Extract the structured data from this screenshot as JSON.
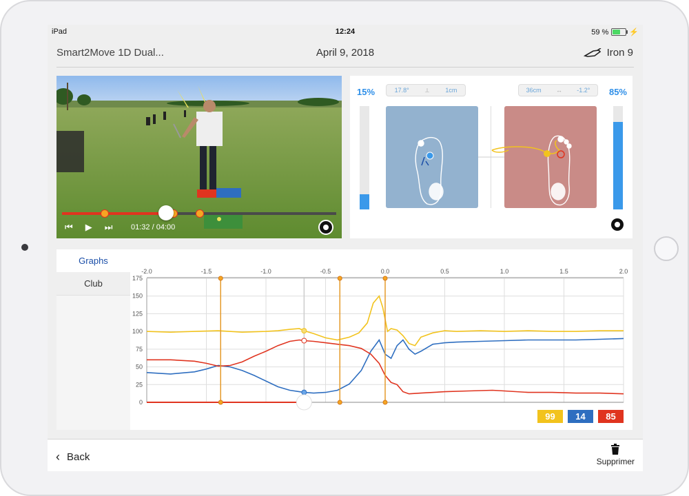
{
  "status": {
    "device": "iPad",
    "time": "12:24",
    "battery": "59 %",
    "battery_level": 0.59
  },
  "header": {
    "app_title": "Smart2Move 1D Dual...",
    "date": "April 9, 2018",
    "club": "Iron 9"
  },
  "video": {
    "current_time": "01:32",
    "duration": "/ 04:00",
    "progress": 0.38
  },
  "balance": {
    "left_pct": "15%",
    "right_pct": "85%",
    "left_level": 0.15,
    "right_level": 0.85,
    "left_angle": "17.8°",
    "left_distance": "1cm",
    "right_distance": "36cm",
    "right_angle": "-1.2°",
    "colors": {
      "left_pad": "#93b2cf",
      "right_pad": "#c98b87",
      "accent": "#2f8fe8"
    }
  },
  "tabs": [
    {
      "label": "Graphs"
    },
    {
      "label": "Club"
    }
  ],
  "legend": {
    "yellow": "99",
    "blue": "14",
    "red": "85"
  },
  "chart_data": {
    "type": "line",
    "x_ticks": [
      "-2.0",
      "-1.5",
      "-1.0",
      "-0.5",
      "0.0",
      "0.5",
      "1.0",
      "1.5",
      "2.0"
    ],
    "y_ticks": [
      "0",
      "25",
      "50",
      "75",
      "100",
      "125",
      "150",
      "175"
    ],
    "xlim": [
      -2.0,
      2.0
    ],
    "ylim": [
      0,
      175
    ],
    "grid": true,
    "markers_x": [
      -1.38,
      -0.38,
      0.0
    ],
    "cursor_x": -0.68,
    "series": [
      {
        "color": "#f2c31d",
        "x": [
          -2.0,
          -1.8,
          -1.6,
          -1.4,
          -1.2,
          -1.0,
          -0.9,
          -0.8,
          -0.72,
          -0.68,
          -0.6,
          -0.5,
          -0.4,
          -0.3,
          -0.22,
          -0.15,
          -0.1,
          -0.05,
          -0.02,
          0.02,
          0.05,
          0.1,
          0.15,
          0.2,
          0.25,
          0.3,
          0.4,
          0.5,
          0.6,
          0.8,
          1.0,
          1.2,
          1.4,
          1.6,
          1.8,
          2.0
        ],
        "y": [
          100,
          99,
          100,
          101,
          99,
          100,
          101,
          103,
          104,
          101,
          97,
          91,
          88,
          92,
          98,
          112,
          140,
          150,
          134,
          100,
          104,
          102,
          94,
          83,
          80,
          92,
          98,
          101,
          100,
          101,
          100,
          101,
          100,
          100,
          101,
          101
        ]
      },
      {
        "color": "#2e6ec0",
        "x": [
          -2.0,
          -1.8,
          -1.6,
          -1.5,
          -1.4,
          -1.3,
          -1.2,
          -1.1,
          -1.0,
          -0.9,
          -0.8,
          -0.72,
          -0.68,
          -0.6,
          -0.5,
          -0.4,
          -0.3,
          -0.2,
          -0.12,
          -0.05,
          0.0,
          0.05,
          0.1,
          0.15,
          0.2,
          0.25,
          0.3,
          0.4,
          0.5,
          0.6,
          0.8,
          1.0,
          1.2,
          1.4,
          1.6,
          1.8,
          2.0
        ],
        "y": [
          42,
          40,
          43,
          47,
          52,
          50,
          45,
          38,
          30,
          22,
          17,
          15,
          14,
          13,
          14,
          17,
          26,
          45,
          72,
          88,
          68,
          62,
          80,
          88,
          75,
          68,
          72,
          82,
          84,
          85,
          86,
          87,
          88,
          88,
          88,
          89,
          90
        ]
      },
      {
        "color": "#e0341f",
        "x": [
          -2.0,
          -1.8,
          -1.6,
          -1.5,
          -1.4,
          -1.3,
          -1.2,
          -1.1,
          -1.0,
          -0.9,
          -0.8,
          -0.72,
          -0.68,
          -0.6,
          -0.5,
          -0.4,
          -0.3,
          -0.2,
          -0.12,
          -0.05,
          0.0,
          0.05,
          0.1,
          0.15,
          0.2,
          0.3,
          0.5,
          0.7,
          0.9,
          1.0,
          1.2,
          1.4,
          1.6,
          1.8,
          2.0
        ],
        "y": [
          60,
          60,
          58,
          55,
          51,
          52,
          57,
          65,
          72,
          80,
          86,
          88,
          87,
          86,
          84,
          82,
          80,
          76,
          68,
          55,
          38,
          28,
          25,
          15,
          12,
          13,
          15,
          16,
          17,
          16,
          14,
          14,
          13,
          13,
          12
        ]
      }
    ]
  }
}
